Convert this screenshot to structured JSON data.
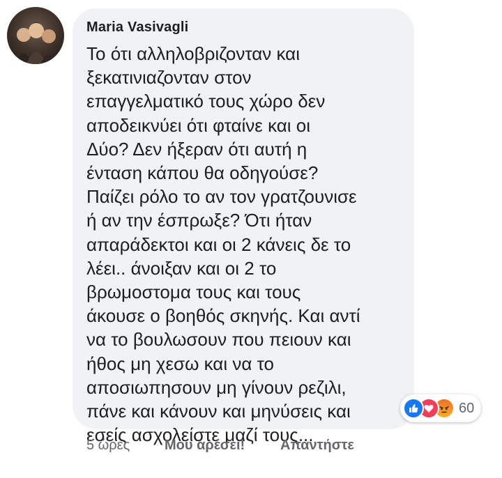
{
  "comment": {
    "author": "Maria Vasivagli",
    "text_lines": [
      "Το ότι αλληλοβριζονταν και",
      "ξεκατινιαζονταν στον",
      "επαγγελματικό τους χώρο δεν",
      "αποδεικνύει ότι φταίνε και οι",
      "Δύο? Δεν ήξεραν ότι αυτή η",
      "ένταση κάπου θα οδηγούσε?",
      "Παίζει ρόλο το αν τον γρατζουνισε",
      "ή αν την έσπρωξε? Ότι ήταν",
      "απαράδεκτοι και οι 2 κάνεις δε το",
      "λέει.. άνοιξαν και οι 2 το",
      "βρωμοστομα τους και τους",
      "άκουσε ο βοηθός σκηνής. Και αντί",
      "να το βουλωσουν που πειουν και",
      "ήθος μη χεσω και να το",
      "αποσιωπησουν μη γίνουν ρεζιλι,",
      "πάνε και κάνουν και μηνύσεις και",
      "εσείς ασχολείστε μαζί τους..."
    ],
    "reactions": {
      "types": [
        "like-icon",
        "love-icon",
        "angry-icon"
      ],
      "count": "60"
    },
    "footer": {
      "time": "5 ώρες",
      "like_label": "Μου αρέσει!",
      "reply_label": "Απαντήστε"
    }
  },
  "colors": {
    "bubble": "#f0f2f5",
    "like": "#1877f2",
    "love": "#f33e58",
    "angry": "#f07a28",
    "meta_text": "#65676b"
  }
}
